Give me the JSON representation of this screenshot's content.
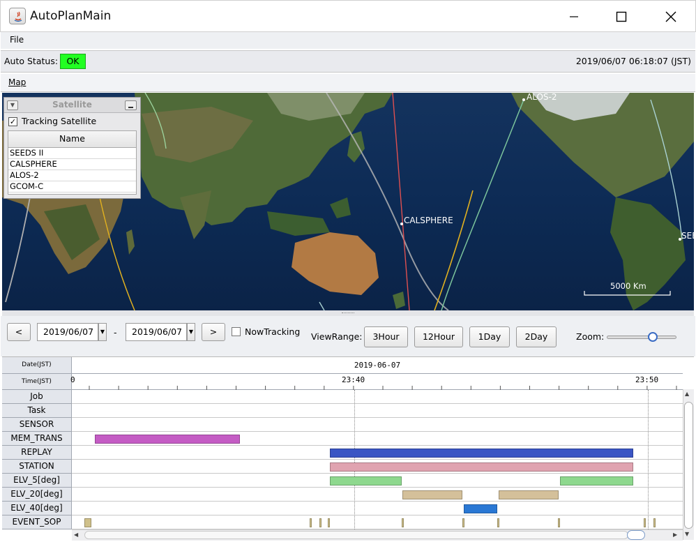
{
  "window": {
    "title": "AutoPlanMain"
  },
  "menu": {
    "file": "File"
  },
  "status": {
    "label": "Auto Status:",
    "value": "OK",
    "datetime": "2019/06/07 06:18:07 (JST)"
  },
  "tabs": {
    "map": "Map"
  },
  "map": {
    "satellite_labels": [
      "ALOS-2",
      "CALSPHERE",
      "SEE"
    ],
    "scale_label": "5000 Km"
  },
  "satellite_panel": {
    "title": "Satellite",
    "tracking_label": "Tracking Satellite",
    "tracking_checked": true,
    "column_header": "Name",
    "rows": [
      "SEEDS II",
      "CALSPHERE",
      "ALOS-2",
      "GCOM-C"
    ]
  },
  "controls": {
    "prev": "<",
    "next": ">",
    "start_date": "2019/06/07",
    "separator": "-",
    "end_date": "2019/06/07",
    "now_tracking": "NowTracking",
    "view_range_label": "ViewRange:",
    "ranges": [
      "3Hour",
      "12Hour",
      "1Day",
      "2Day"
    ],
    "zoom_label": "Zoom:",
    "zoom_level": 0.66
  },
  "timeline": {
    "date_header": "Date(JST)",
    "time_header": "Time(JST)",
    "date_value": "2019-06-07",
    "time_ticks": [
      "0",
      "23:40",
      "23:50"
    ],
    "rows": [
      "Job",
      "Task",
      "SENSOR",
      "MEM_TRANS",
      "REPLAY",
      "STATION",
      "ELV_5[deg]",
      "ELV_20[deg]",
      "ELV_40[deg]",
      "EVENT_SOP"
    ],
    "colors": {
      "MEM_TRANS": "#c45cc4",
      "REPLAY": "#3a55c4",
      "STATION": "#e0a3b0",
      "ELV_5": "#8ed88e",
      "ELV_20": "#d4c09a",
      "ELV_40": "#2a78d4",
      "EVENT_SOP": "#cfc08a"
    }
  }
}
